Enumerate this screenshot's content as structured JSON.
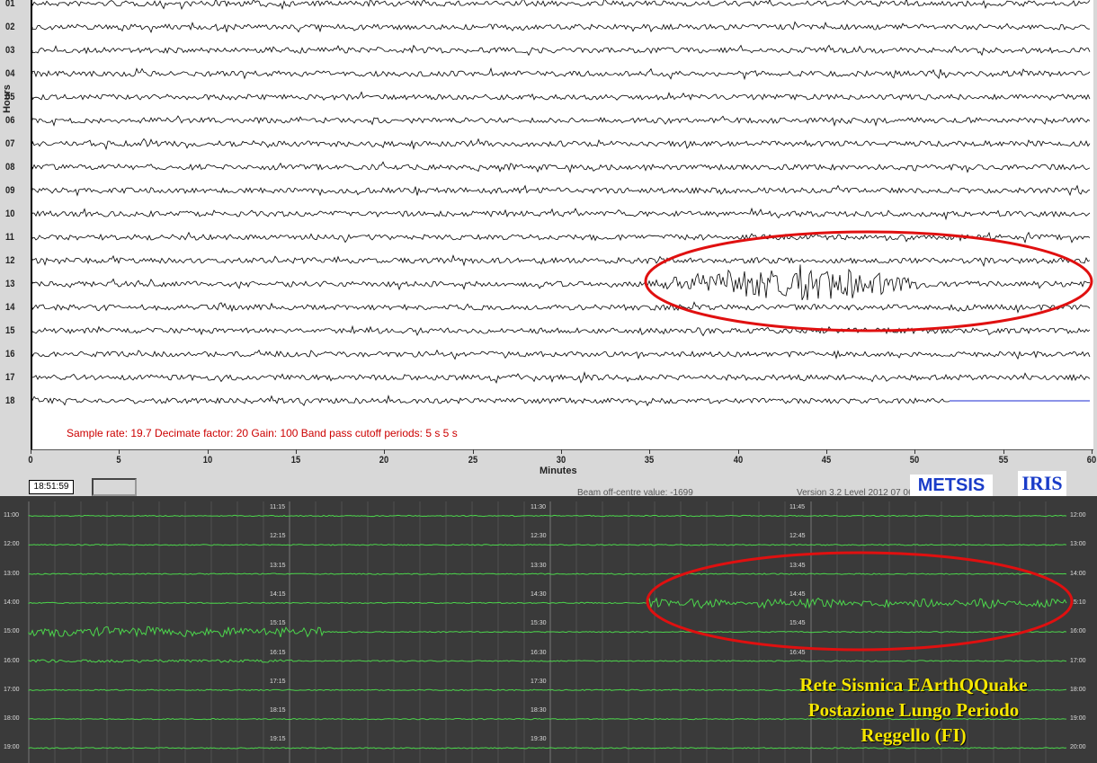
{
  "top_panel": {
    "y_axis_title": "Hours",
    "hour_labels": [
      "01",
      "02",
      "03",
      "04",
      "05",
      "06",
      "07",
      "08",
      "09",
      "10",
      "11",
      "12",
      "13",
      "14",
      "15",
      "16",
      "17",
      "18"
    ],
    "x_ticks": [
      "0",
      "5",
      "10",
      "15",
      "20",
      "25",
      "30",
      "35",
      "40",
      "45",
      "50",
      "55",
      "60"
    ],
    "x_axis_title": "Minutes",
    "info_text": "Sample rate: 19.7  Decimate factor: 20  Gain: 100  Band pass cutoff periods: 5 s 5 s",
    "time_display": "18:51:59",
    "beam_text": "Beam off-centre value: -1699",
    "version_text": "Version 3.2 Level 2012 07 06",
    "logo_metsis": "METSIS",
    "logo_iris": "IRIS",
    "trace_color": "#000000",
    "annotation_color": "#e01010"
  },
  "bottom_panel": {
    "left_labels": [
      "11:00",
      "12:00",
      "13:00",
      "14:00",
      "15:00",
      "16:00",
      "17:00",
      "18:00",
      "19:00"
    ],
    "right_labels": [
      "12:00",
      "13:00",
      "14:00",
      "15:10",
      "16:00",
      "17:00",
      "18:00",
      "19:00",
      "20:00"
    ],
    "mid_labels_1": [
      "11:15",
      "12:15",
      "13:15",
      "14:15",
      "15:15",
      "16:15",
      "17:15",
      "18:15",
      "19:15"
    ],
    "mid_labels_2": [
      "11:30",
      "12:30",
      "13:30",
      "14:30",
      "15:30",
      "16:30",
      "17:30",
      "18:30",
      "19:30"
    ],
    "mid_labels_3": [
      "11:45",
      "12:45",
      "13:45",
      "14:45",
      "15:45",
      "16:45",
      "",
      "",
      ""
    ],
    "trace_color": "#4cd64c",
    "caption_line1": "Rete Sismica EArthQQuake",
    "caption_line2": "Postazione Lungo Periodo",
    "caption_line3": "Reggello (FI)"
  }
}
